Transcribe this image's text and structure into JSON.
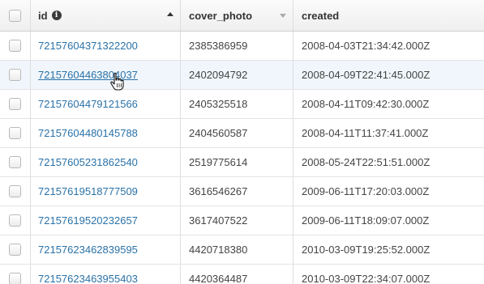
{
  "columns": {
    "select_all": "",
    "id": "id",
    "cover_photo": "cover_photo",
    "created": "created"
  },
  "icons": {
    "id_info": "info-icon",
    "id_sort": "sort-ascending-icon",
    "cover_photo_sort": "sort-icon",
    "cursor": "hand-pointer-icon"
  },
  "colors": {
    "link": "#2a72a8",
    "hover_row": "#f0f6fb"
  },
  "rows": [
    {
      "id": "72157604371322200",
      "cover_photo": "2385386959",
      "created": "2008-04-03T21:34:42.000Z"
    },
    {
      "id": "72157604463804037",
      "cover_photo": "2402094792",
      "created": "2008-04-09T22:41:45.000Z"
    },
    {
      "id": "72157604479121566",
      "cover_photo": "2405325518",
      "created": "2008-04-11T09:42:30.000Z"
    },
    {
      "id": "72157604480145788",
      "cover_photo": "2404560587",
      "created": "2008-04-11T11:37:41.000Z"
    },
    {
      "id": "72157605231862540",
      "cover_photo": "2519775614",
      "created": "2008-05-24T22:51:51.000Z"
    },
    {
      "id": "72157619518777509",
      "cover_photo": "3616546267",
      "created": "2009-06-11T17:20:03.000Z"
    },
    {
      "id": "72157619520232657",
      "cover_photo": "3617407522",
      "created": "2009-06-11T18:09:07.000Z"
    },
    {
      "id": "72157623462839595",
      "cover_photo": "4420718380",
      "created": "2010-03-09T19:25:52.000Z"
    },
    {
      "id": "72157623463955403",
      "cover_photo": "4420364487",
      "created": "2010-03-09T22:34:07.000Z"
    }
  ]
}
